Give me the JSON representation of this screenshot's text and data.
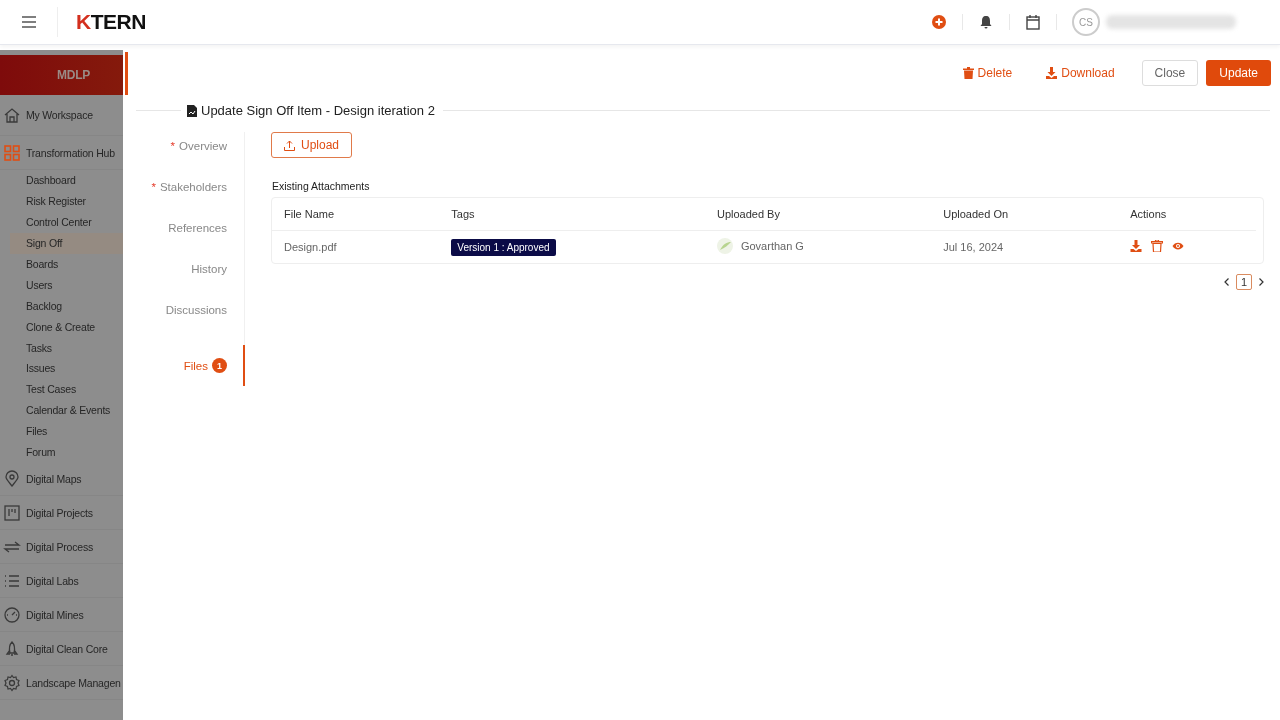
{
  "topbar": {
    "logo": "KTERN",
    "avatar_initials": "CS"
  },
  "sidebar": {
    "header": "MDLP",
    "items": [
      {
        "label": "My Workspace"
      },
      {
        "label": "Transformation Hub",
        "children": [
          {
            "label": "Dashboard",
            "selected": false
          },
          {
            "label": "Risk Register",
            "selected": false
          },
          {
            "label": "Control Center",
            "selected": false
          },
          {
            "label": "Sign Off",
            "selected": true
          },
          {
            "label": "Boards",
            "selected": false
          },
          {
            "label": "Users",
            "selected": false
          },
          {
            "label": "Backlog",
            "selected": false
          },
          {
            "label": "Clone & Create",
            "selected": false
          },
          {
            "label": "Tasks",
            "selected": false
          },
          {
            "label": "Issues",
            "selected": false
          },
          {
            "label": "Test Cases",
            "selected": false
          },
          {
            "label": "Calendar & Events",
            "selected": false
          },
          {
            "label": "Files",
            "selected": false
          },
          {
            "label": "Forum",
            "selected": false
          }
        ]
      },
      {
        "label": "Digital Maps"
      },
      {
        "label": "Digital Projects"
      },
      {
        "label": "Digital Process"
      },
      {
        "label": "Digital Labs"
      },
      {
        "label": "Digital Mines"
      },
      {
        "label": "Digital Clean Core"
      },
      {
        "label": "Landscape Managen"
      }
    ]
  },
  "toolbar": {
    "buttons": [
      {
        "label": "Delete",
        "kind": "delete"
      },
      {
        "label": "Download",
        "kind": "download"
      },
      {
        "label": "Close",
        "kind": "outline"
      },
      {
        "label": "Update",
        "kind": "primary"
      }
    ]
  },
  "title": "Update Sign Off Item - Design iteration 2",
  "sections": [
    {
      "label": "Overview",
      "marker": "*",
      "selected": false
    },
    {
      "label": "Stakeholders",
      "marker": "*",
      "selected": false
    },
    {
      "label": "References",
      "selected": false
    },
    {
      "label": "History",
      "selected": false
    },
    {
      "label": "Discussions",
      "selected": false
    },
    {
      "label": "Files",
      "badge": "1",
      "selected": true
    }
  ],
  "upload_button": "Upload",
  "attachments": {
    "heading": "Existing Attachments",
    "columns": [
      "File Name",
      "Tags",
      "Uploaded By",
      "Uploaded On",
      "Actions"
    ],
    "rows": [
      {
        "file": "Design.pdf",
        "tag": "Version 1 : Approved",
        "uploaded_by": "Govarthan G",
        "uploaded_on": "Jul 16, 2024"
      }
    ]
  },
  "pagination": {
    "pages": [
      {
        "label": "1",
        "selected": true
      }
    ]
  }
}
